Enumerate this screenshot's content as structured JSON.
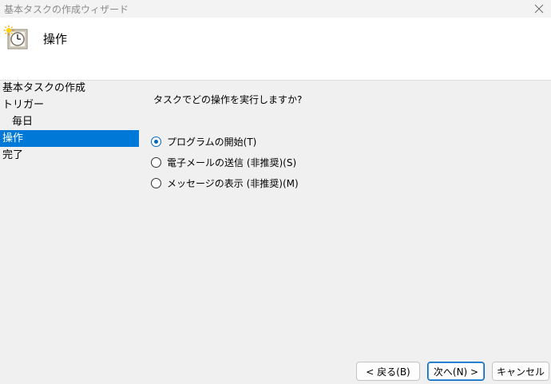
{
  "window": {
    "title": "基本タスクの作成ウィザード"
  },
  "header": {
    "heading": "操作"
  },
  "steps": [
    {
      "label": "基本タスクの作成",
      "active": false
    },
    {
      "label": "トリガー",
      "active": false
    },
    {
      "label": "毎日",
      "active": false,
      "sub": true
    },
    {
      "label": "操作",
      "active": true
    },
    {
      "label": "完了",
      "active": false
    }
  ],
  "main": {
    "question": "タスクでどの操作を実行しますか?",
    "options": [
      {
        "label": "プログラムの開始(T)",
        "checked": true
      },
      {
        "label": "電子メールの送信 (非推奨)(S)",
        "checked": false
      },
      {
        "label": "メッセージの表示 (非推奨)(M)",
        "checked": false
      }
    ]
  },
  "buttons": {
    "back": "< 戻る(B)",
    "next": "次へ(N) >",
    "cancel": "キャンセル"
  },
  "colors": {
    "accent": "#0078d7",
    "radio_selected": "#0067c0"
  },
  "icons": {
    "close": "close-icon",
    "wizard": "task-scheduler-clock-icon"
  }
}
